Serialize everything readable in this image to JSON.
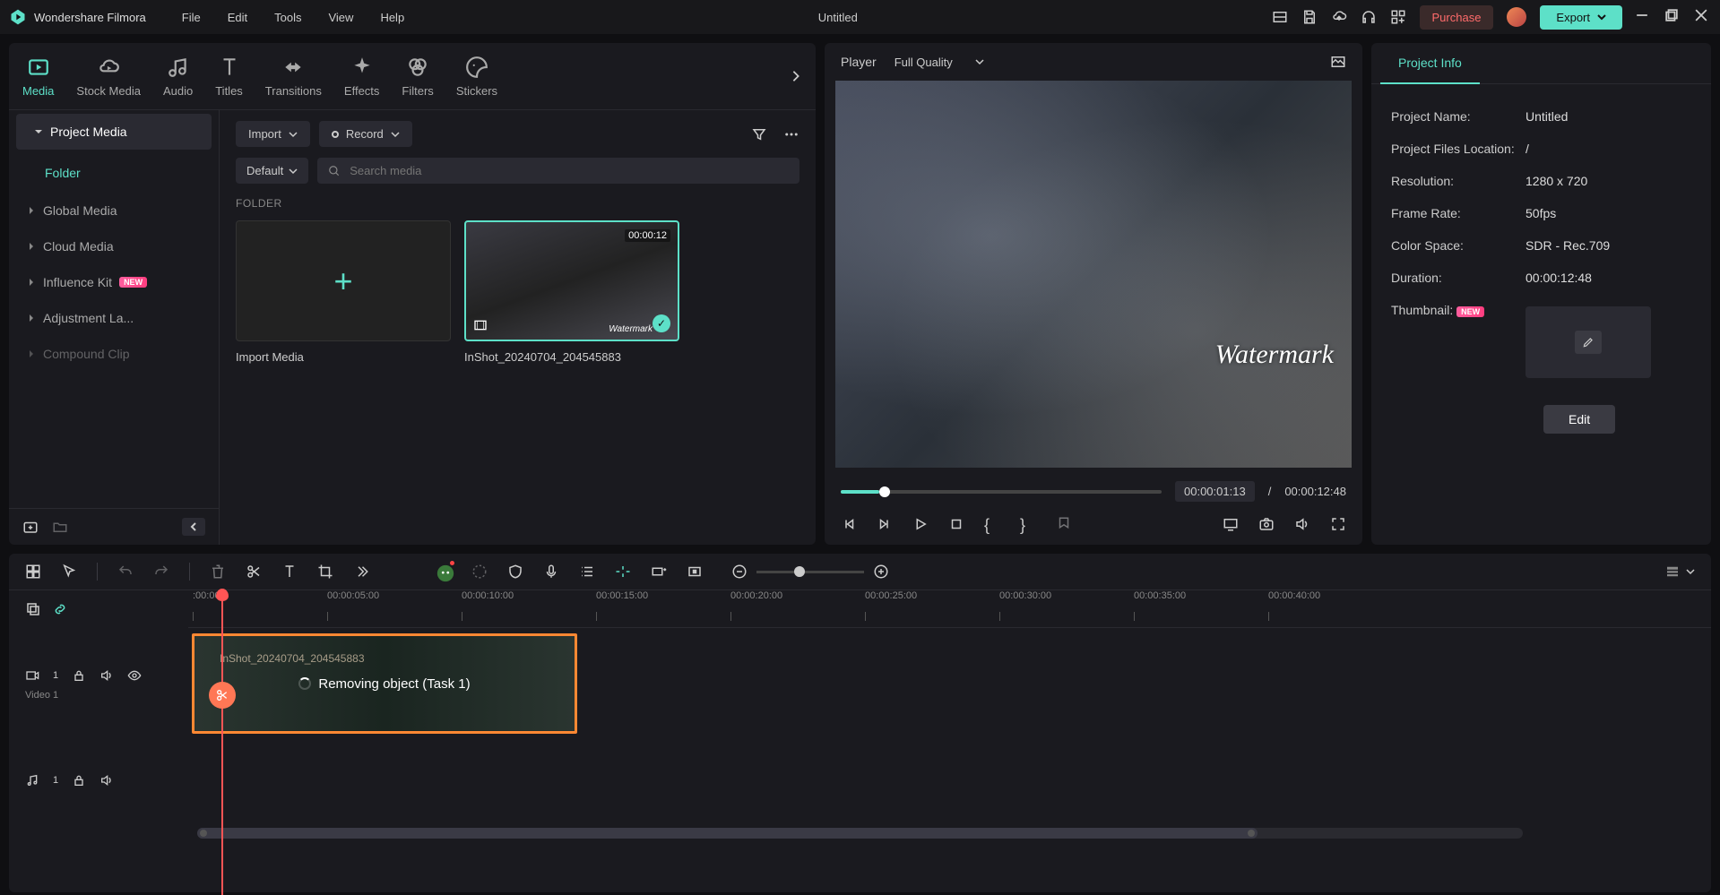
{
  "app": {
    "name": "Wondershare Filmora",
    "title": "Untitled"
  },
  "menu": [
    "File",
    "Edit",
    "Tools",
    "View",
    "Help"
  ],
  "titleButtons": {
    "purchase": "Purchase",
    "export": "Export"
  },
  "mediaTabs": [
    {
      "label": "Media",
      "active": true
    },
    {
      "label": "Stock Media"
    },
    {
      "label": "Audio"
    },
    {
      "label": "Titles"
    },
    {
      "label": "Transitions"
    },
    {
      "label": "Effects"
    },
    {
      "label": "Filters"
    },
    {
      "label": "Stickers"
    }
  ],
  "sidebar": {
    "items": [
      {
        "label": "Project Media",
        "active": true
      },
      {
        "label": "Global Media"
      },
      {
        "label": "Cloud Media"
      },
      {
        "label": "Influence Kit",
        "badge": "NEW"
      },
      {
        "label": "Adjustment La..."
      },
      {
        "label": "Compound Clip"
      }
    ],
    "folder": "Folder"
  },
  "mediaToolbar": {
    "import": "Import",
    "record": "Record",
    "sort": "Default",
    "searchPlaceholder": "Search media"
  },
  "folderLabel": "FOLDER",
  "mediaItems": {
    "importCard": "Import Media",
    "clip": {
      "duration": "00:00:12",
      "name": "InShot_20240704_204545883",
      "watermark": "Watermark"
    }
  },
  "player": {
    "label": "Player",
    "quality": "Full Quality",
    "watermark": "Watermark",
    "current": "00:00:01:13",
    "sep": "/",
    "total": "00:00:12:48"
  },
  "projectInfo": {
    "tab": "Project Info",
    "rows": {
      "name": {
        "k": "Project Name:",
        "v": "Untitled"
      },
      "location": {
        "k": "Project Files Location:",
        "v": "/"
      },
      "resolution": {
        "k": "Resolution:",
        "v": "1280 x 720"
      },
      "framerate": {
        "k": "Frame Rate:",
        "v": "50fps"
      },
      "colorspace": {
        "k": "Color Space:",
        "v": "SDR - Rec.709"
      },
      "duration": {
        "k": "Duration:",
        "v": "00:00:12:48"
      },
      "thumbnail": {
        "k": "Thumbnail:",
        "badge": "NEW"
      }
    },
    "editBtn": "Edit"
  },
  "timeline": {
    "ticks": [
      ":00:00",
      "00:00:05:00",
      "00:00:10:00",
      "00:00:15:00",
      "00:00:20:00",
      "00:00:25:00",
      "00:00:30:00",
      "00:00:35:00",
      "00:00:40:00"
    ],
    "videoTrack": {
      "label": "Video 1",
      "num": "1"
    },
    "audioTrack": {
      "num": "1"
    },
    "clip": {
      "filename": "InShot_20240704_204545883",
      "status": "Removing object (Task   1)"
    }
  }
}
